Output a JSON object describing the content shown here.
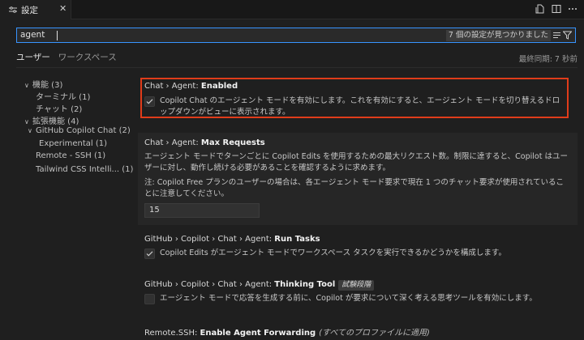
{
  "tab": {
    "title": "設定",
    "close": "✕"
  },
  "search": {
    "value": "agent",
    "result_count": "7 個の設定が見つかりました"
  },
  "scope_tabs": {
    "user": "ユーザー",
    "workspace": "ワークスペース"
  },
  "sync_status": "最終同期: 7 秒前",
  "toc": [
    {
      "label": "機能 (3)",
      "chevron": "∨"
    },
    {
      "label": "ターミナル (1)",
      "chevron": ""
    },
    {
      "label": "チャット (2)",
      "chevron": ""
    },
    {
      "label": "拡張機能 (4)",
      "chevron": "∨"
    },
    {
      "label": "GitHub Copilot Chat (2)",
      "chevron": "∨"
    },
    {
      "label": "Experimental (1)",
      "chevron": ""
    },
    {
      "label": "Remote - SSH (1)",
      "chevron": ""
    },
    {
      "label": "Tailwind CSS Intelli...   (1)",
      "chevron": ""
    }
  ],
  "settings": [
    {
      "prefix": "Chat › Agent: ",
      "name": "Enabled",
      "checked": true,
      "description": "Copilot Chat のエージェント モードを有効にします。これを有効にすると、エージェント モードを切り替えるドロップダウンがビューに表示されます。"
    },
    {
      "prefix": "Chat › Agent: ",
      "name": "Max Requests",
      "description": "エージェント モードでターンごとに Copilot Edits を使用するための最大リクエスト数。制限に達すると、Copilot はユーザーに対し、動作し続ける必要があることを確認するように求めます。",
      "note": "注: Copilot Free プランのユーザーの場合は、各エージェント モード要求で現在 1 つのチャット要求が使用されていることに注意してください。",
      "value": "15"
    },
    {
      "prefix": "GitHub › Copilot › Chat › Agent: ",
      "name": "Run Tasks",
      "checked": true,
      "description": "Copilot Edits がエージェント モードでワークスペース タスクを実行できるかどうかを構成します。"
    },
    {
      "prefix": "GitHub › Copilot › Chat › Agent: ",
      "name": "Thinking Tool",
      "badge": "試験段階",
      "checked": false,
      "description": "エージェント モードで応答を生成する前に、Copilot が要求について深く考える思考ツールを有効にします。"
    },
    {
      "prefix": "Remote.SSH: ",
      "name": "Enable Agent Forwarding",
      "note": "(すべてのプロファイルに適用)"
    }
  ],
  "colors": {
    "accent": "#3794ff",
    "highlight": "#e03c1a",
    "background": "#1f1f1f"
  }
}
